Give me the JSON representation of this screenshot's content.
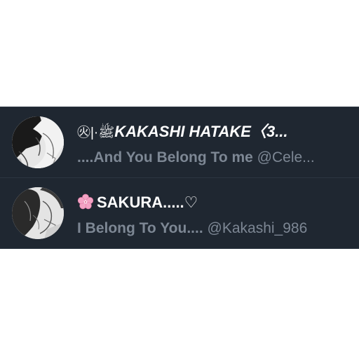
{
  "colors": {
    "panel_bg": "#1f2731",
    "name_text": "#ffffff",
    "bio_text": "#7d8794",
    "flower": "#f3a3c4"
  },
  "entries": [
    {
      "name_prefix": "㊋|·ﷺ",
      "name": "KAKASHI HATAKE〈3...",
      "bio_main": "....And You Belong To me",
      "bio_handle": " @Cele...",
      "avatar_icon": "manga-couple-avatar"
    },
    {
      "name_icon": "cherry-blossom-icon",
      "name": "SAKURA.....♡",
      "bio_main": "I Belong To You....",
      "bio_handle": " @Kakashi_986",
      "avatar_icon": "manga-couple-avatar"
    }
  ]
}
